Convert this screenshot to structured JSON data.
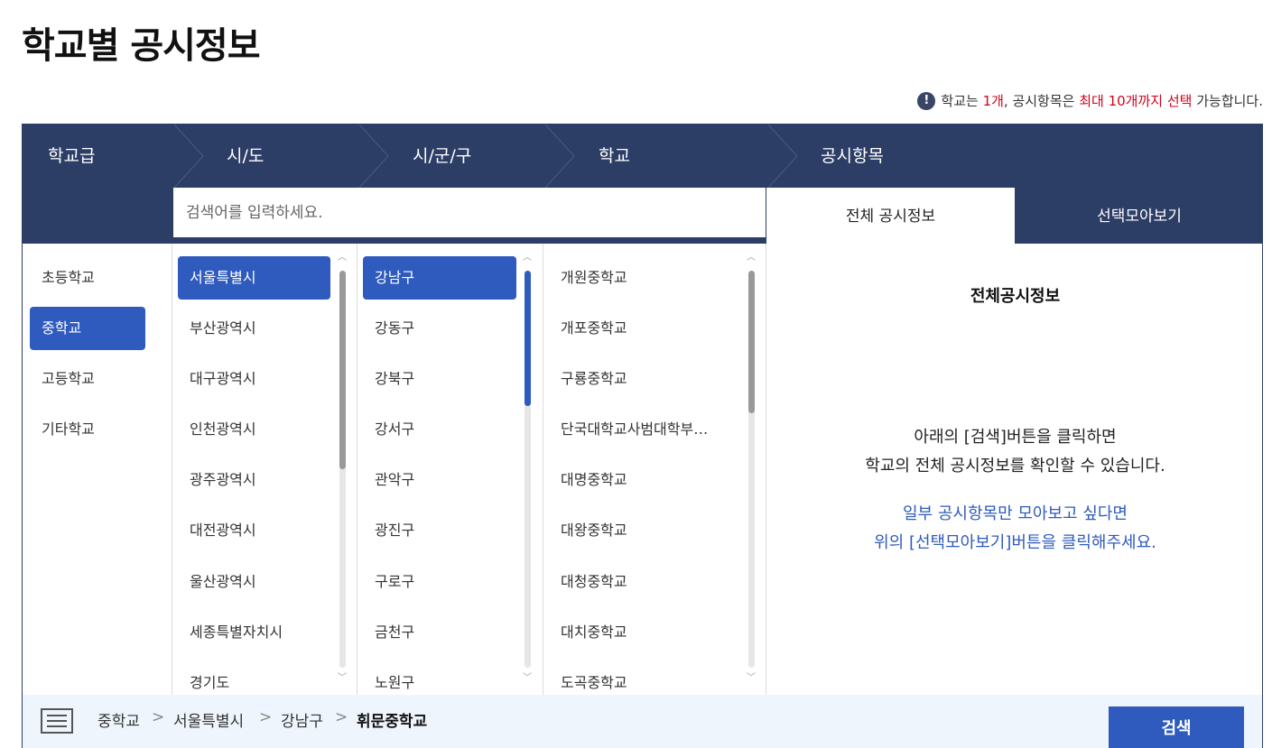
{
  "page": {
    "title": "학교별 공시정보"
  },
  "notice": {
    "icon": "info-icon",
    "parts": [
      "학교는 ",
      "1개",
      ", 공시항목은 ",
      "최대 10개까지 선택",
      " 가능합니다."
    ],
    "highlight_color": "#d0021b"
  },
  "steps": [
    "학교급",
    "시/도",
    "시/군/구",
    "학교",
    "공시항목"
  ],
  "search": {
    "placeholder": "검색어를 입력하세요.",
    "value": ""
  },
  "tabs": {
    "all_label": "전체 공시정보",
    "selected_label": "선택모아보기",
    "active": "전체 공시정보"
  },
  "school_levels": {
    "items": [
      "초등학교",
      "중학교",
      "고등학교",
      "기타학교"
    ],
    "selected": "중학교"
  },
  "sido": {
    "items": [
      "서울특별시",
      "부산광역시",
      "대구광역시",
      "인천광역시",
      "광주광역시",
      "대전광역시",
      "울산광역시",
      "세종특별자치시",
      "경기도"
    ],
    "selected": "서울특별시"
  },
  "sigungu": {
    "items": [
      "강남구",
      "강동구",
      "강북구",
      "강서구",
      "관악구",
      "광진구",
      "구로구",
      "금천구",
      "노원구"
    ],
    "selected": "강남구"
  },
  "schools": {
    "items": [
      "개원중학교",
      "개포중학교",
      "구룡중학교",
      "단국대학교사범대학부…",
      "대명중학교",
      "대왕중학교",
      "대청중학교",
      "대치중학교",
      "도곡중학교"
    ]
  },
  "info": {
    "title": "전체공시정보",
    "line1": "아래의 [검색]버튼을 클릭하면",
    "line2": "학교의 전체 공시정보를 확인할 수 있습니다.",
    "line3": "일부 공시항목만 모아보고 싶다면",
    "line4": "위의 [선택모아보기]버튼을 클릭해주세요."
  },
  "breadcrumb": {
    "items": [
      "중학교",
      "서울특별시",
      "강남구",
      "휘문중학교"
    ],
    "separator": ">",
    "icon": "list-icon"
  },
  "search_button": {
    "label": "검색"
  },
  "colors": {
    "navy": "#2d3e66",
    "accent_blue": "#2e5bbd",
    "bottom_bg": "#eef5fc"
  }
}
